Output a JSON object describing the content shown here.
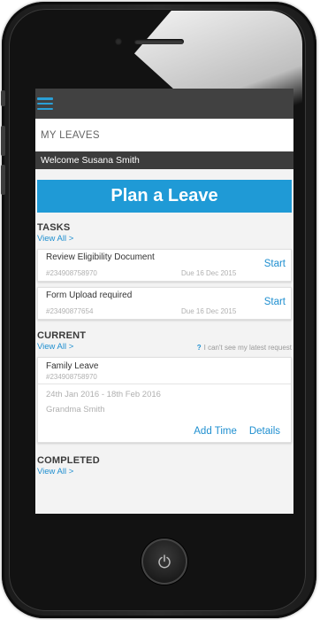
{
  "app": {
    "menu_icon": "hamburger-menu-icon",
    "page_title": "MY LEAVES",
    "welcome_text": "Welcome Susana Smith",
    "plan_button": "Plan a Leave",
    "accent_color": "#1f9ad6"
  },
  "tasks": {
    "heading": "TASKS",
    "view_all": "View All >",
    "items": [
      {
        "title": "Review Eligibility Document",
        "id": "#234908758970",
        "due": "Due 16 Dec 2015",
        "action": "Start"
      },
      {
        "title": "Form Upload required",
        "id": "#23490877654",
        "due": "Due 16 Dec 2015",
        "action": "Start"
      }
    ]
  },
  "current": {
    "heading": "CURRENT",
    "view_all": "View All >",
    "help_mark": "?",
    "help_text": "I can't see my latest request",
    "item": {
      "title": "Family Leave",
      "id": "#234908758970",
      "dates": "24th Jan 2016 - 18th Feb 2016",
      "person": "Grandma Smith",
      "add_time": "Add Time",
      "details": "Details"
    }
  },
  "completed": {
    "heading": "COMPLETED",
    "view_all": "View All >"
  },
  "device": {
    "home_button_icon": "power-icon"
  }
}
